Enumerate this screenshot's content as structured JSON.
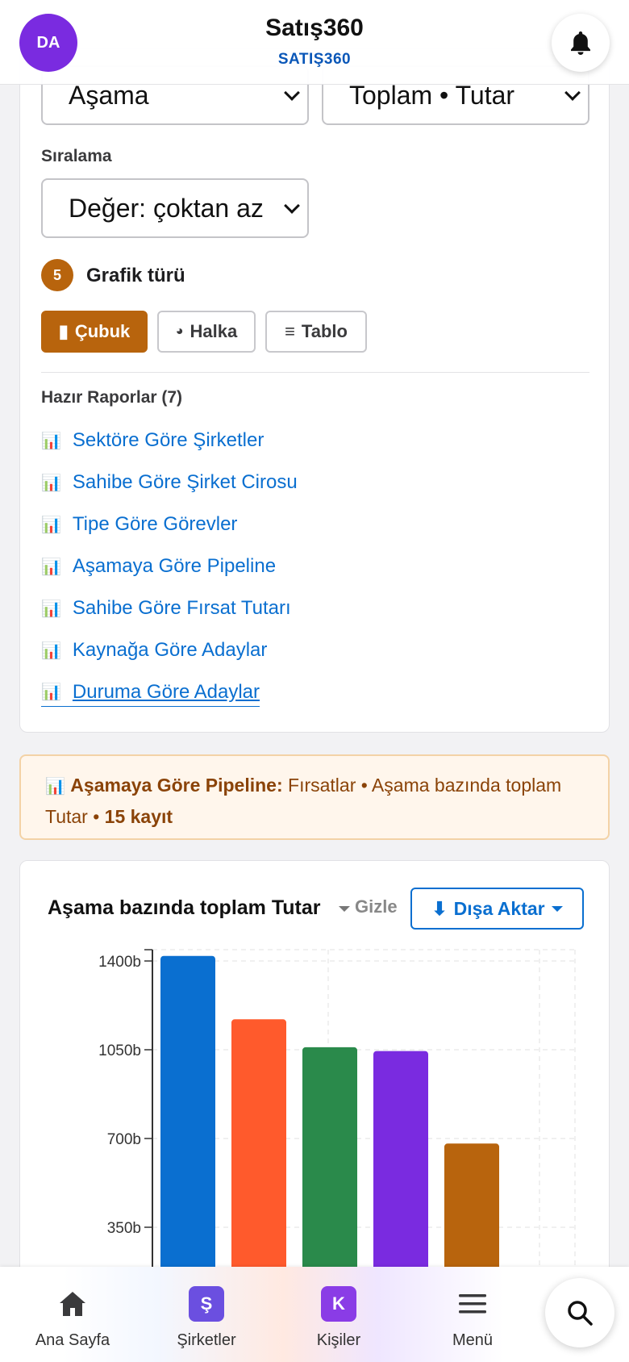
{
  "header": {
    "avatar_initials": "DA",
    "title": "Satış360",
    "subtitle": "SATIŞ360",
    "bell_icon": "bell-icon"
  },
  "builder": {
    "group_select_value": "Aşama",
    "measure_select_value": "Toplam • Tutar",
    "sort_label": "Sıralama",
    "sort_select_value": "Değer: çoktan az",
    "step_number": "5",
    "step_title": "Grafik türü",
    "chart_types": [
      {
        "icon": "▮",
        "label": "Çubuk",
        "active": true
      },
      {
        "icon": "◕",
        "label": "Halka",
        "active": false
      },
      {
        "icon": "≡",
        "label": "Tablo",
        "active": false
      }
    ],
    "reports_heading": "Hazır Raporlar (7)",
    "reports": [
      "Sektöre Göre Şirketler",
      "Sahibe Göre Şirket Cirosu",
      "Tipe Göre Görevler",
      "Aşamaya Göre Pipeline",
      "Sahibe Göre Fırsat Tutarı",
      "Kaynağa Göre Adaylar",
      "Duruma Göre Adaylar"
    ],
    "report_icon": "📊"
  },
  "summary": {
    "icon": "📊",
    "report_name": "Aşamaya Göre Pipeline:",
    "description": "Fırsatlar • Aşama bazında toplam Tutar •",
    "count": "15 kayıt"
  },
  "chart_panel": {
    "title": "Aşama bazında toplam Tutar",
    "hide_label": "Gizle",
    "export_label": "Dışa Aktar",
    "export_icon": "⬇"
  },
  "chart_data": {
    "type": "bar",
    "title": "Aşama bazında toplam Tutar",
    "xlabel": "",
    "ylabel": "",
    "y_ticks": [
      "350b",
      "700b",
      "1050b",
      "1400b"
    ],
    "y_tick_values": [
      350,
      700,
      1050,
      1400
    ],
    "ylim": [
      0,
      1400
    ],
    "grid": true,
    "series": [
      {
        "values": [
          1420,
          1170,
          1060,
          1045,
          680
        ],
        "colors": [
          "#0a6fd0",
          "#ff5a2c",
          "#2a8a4b",
          "#7a2be0",
          "#b8640d"
        ]
      }
    ]
  },
  "bottom_nav": {
    "items": [
      {
        "label": "Ana Sayfa",
        "icon": "home-icon"
      },
      {
        "label": "Şirketler",
        "icon": "Ş",
        "color": "#6b4fe0"
      },
      {
        "label": "Kişiler",
        "icon": "K",
        "color": "#8a3ce6"
      },
      {
        "label": "Menü",
        "icon": "menu-icon"
      }
    ],
    "search_icon": "search-icon"
  }
}
